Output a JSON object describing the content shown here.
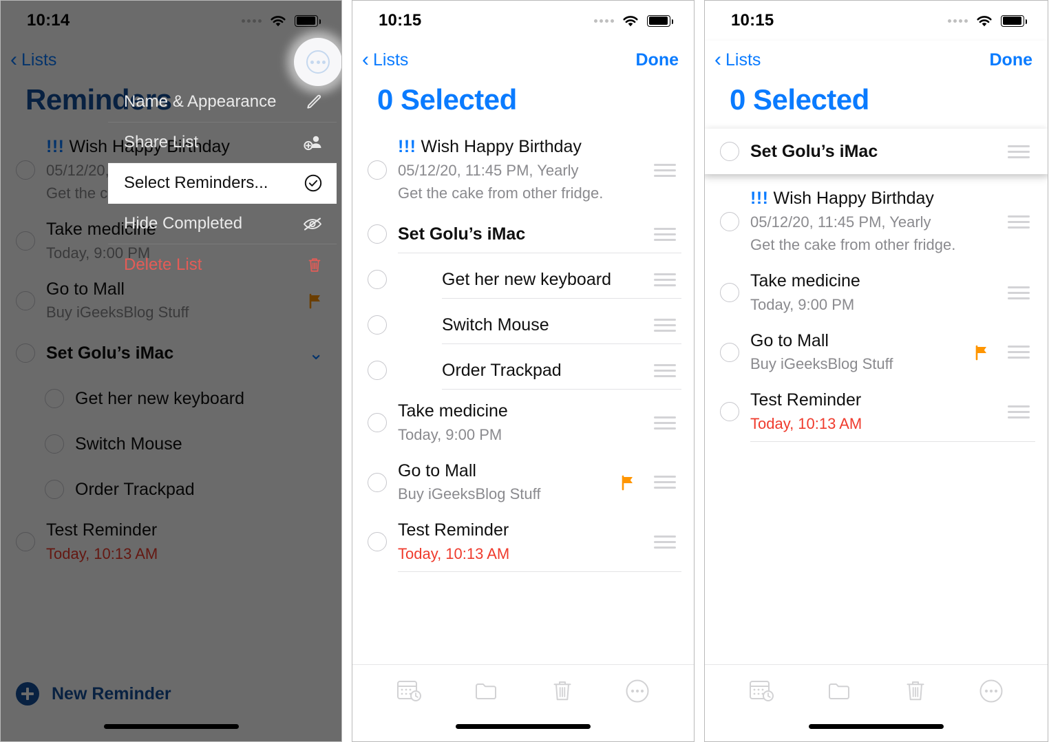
{
  "app": "Reminders",
  "panels": [
    {
      "id": "panel-context-menu",
      "status_bar": {
        "time": "10:14",
        "wifi_icon": "wifi-icon",
        "battery_icon": "battery-icon",
        "signal_icon": "signal-dots-icon"
      },
      "nav": {
        "back_label": "Lists",
        "back_icon": "chevron-left-icon",
        "more_icon": "ellipsis-circle-icon"
      },
      "title": "Reminders",
      "context_menu": [
        {
          "label": "Name & Appearance",
          "icon": "pencil-icon",
          "highlighted": false,
          "danger": false
        },
        {
          "label": "Share List",
          "icon": "person-add-icon",
          "highlighted": false,
          "danger": false
        },
        {
          "label": "Select Reminders...",
          "icon": "checkmark-circle-icon",
          "highlighted": true,
          "danger": false
        },
        {
          "label": "Hide Completed",
          "icon": "eye-slash-icon",
          "highlighted": false,
          "danger": false
        },
        {
          "label": "Delete List",
          "icon": "trash-icon",
          "highlighted": false,
          "danger": true
        }
      ],
      "reminders": [
        {
          "priority": "!!!",
          "title": "Wish Happy Birthday",
          "date": "05/12/20, 11:45 PM, Yearly",
          "note": "Get the cake from other fridge.",
          "bold": false,
          "indent": false,
          "flag": false,
          "chevron": false
        },
        {
          "priority": "",
          "title": "Take medicine",
          "date": "Today, 9:00 PM",
          "note": "",
          "bold": false,
          "indent": false,
          "flag": false,
          "chevron": false
        },
        {
          "priority": "",
          "title": "Go to Mall",
          "date": "Buy iGeeksBlog Stuff",
          "note": "",
          "bold": false,
          "indent": false,
          "flag": true,
          "chevron": false
        },
        {
          "priority": "",
          "title": "Set Golu’s iMac",
          "date": "",
          "note": "",
          "bold": true,
          "indent": false,
          "flag": false,
          "chevron": true
        },
        {
          "priority": "",
          "title": "Get her new keyboard",
          "date": "",
          "note": "",
          "bold": false,
          "indent": true,
          "flag": false,
          "chevron": false
        },
        {
          "priority": "",
          "title": "Switch Mouse",
          "date": "",
          "note": "",
          "bold": false,
          "indent": true,
          "flag": false,
          "chevron": false
        },
        {
          "priority": "",
          "title": "Order Trackpad",
          "date": "",
          "note": "",
          "bold": false,
          "indent": true,
          "flag": false,
          "chevron": false
        },
        {
          "priority": "",
          "title": "Test Reminder",
          "date": "Today, 10:13 AM",
          "note": "",
          "date_overdue": true,
          "bold": false,
          "indent": false,
          "flag": false,
          "chevron": false
        }
      ],
      "new_reminder": {
        "label": "New Reminder",
        "icon": "plus-circle-icon"
      }
    },
    {
      "id": "panel-select-mode",
      "status_bar": {
        "time": "10:15",
        "wifi_icon": "wifi-icon",
        "battery_icon": "battery-icon",
        "signal_icon": "signal-dots-icon"
      },
      "nav": {
        "back_label": "Lists",
        "back_icon": "chevron-left-icon",
        "done_label": "Done"
      },
      "title": "0 Selected",
      "reminders": [
        {
          "priority": "!!!",
          "title": "Wish Happy Birthday",
          "date": "05/12/20, 11:45 PM, Yearly",
          "note": "Get the cake from other fridge.",
          "bold": false,
          "indent": false,
          "flag": false,
          "grip": true
        },
        {
          "priority": "",
          "title": "Set Golu’s iMac",
          "date": "",
          "note": "",
          "bold": true,
          "indent": false,
          "flag": false,
          "grip": true
        },
        {
          "priority": "",
          "title": "Get her new keyboard",
          "date": "",
          "note": "",
          "bold": false,
          "indent": true,
          "flag": false,
          "grip": true
        },
        {
          "priority": "",
          "title": "Switch Mouse",
          "date": "",
          "note": "",
          "bold": false,
          "indent": true,
          "flag": false,
          "grip": true
        },
        {
          "priority": "",
          "title": "Order Trackpad",
          "date": "",
          "note": "",
          "bold": false,
          "indent": true,
          "flag": false,
          "grip": true
        },
        {
          "priority": "",
          "title": "Take medicine",
          "date": "Today, 9:00 PM",
          "note": "",
          "bold": false,
          "indent": false,
          "flag": false,
          "grip": true
        },
        {
          "priority": "",
          "title": "Go to Mall",
          "date": "Buy iGeeksBlog Stuff",
          "note": "",
          "bold": false,
          "indent": false,
          "flag": true,
          "grip": true
        },
        {
          "priority": "",
          "title": "Test Reminder",
          "date": "Today, 10:13 AM",
          "note": "",
          "date_overdue": true,
          "bold": false,
          "indent": false,
          "flag": false,
          "grip": true
        }
      ],
      "toolbar": [
        {
          "icon": "calendar-clock-icon",
          "name": "schedule-button"
        },
        {
          "icon": "folder-icon",
          "name": "move-to-list-button"
        },
        {
          "icon": "trash-icon",
          "name": "delete-button"
        },
        {
          "icon": "ellipsis-circle-icon",
          "name": "more-button"
        }
      ]
    },
    {
      "id": "panel-reorder",
      "status_bar": {
        "time": "10:15",
        "wifi_icon": "wifi-icon",
        "battery_icon": "battery-icon",
        "signal_icon": "signal-dots-icon"
      },
      "nav": {
        "back_label": "Lists",
        "back_icon": "chevron-left-icon",
        "done_label": "Done"
      },
      "title": "0 Selected",
      "dragged": {
        "priority": "",
        "title": "Set Golu’s iMac",
        "date": "",
        "note": "",
        "bold": true,
        "indent": false,
        "flag": false,
        "grip": true
      },
      "reminders": [
        {
          "priority": "!!!",
          "title": "Wish Happy Birthday",
          "date": "05/12/20, 11:45 PM, Yearly",
          "note": "Get the cake from other fridge.",
          "bold": false,
          "indent": false,
          "flag": false,
          "grip": true
        },
        {
          "priority": "",
          "title": "Take medicine",
          "date": "Today, 9:00 PM",
          "note": "",
          "bold": false,
          "indent": false,
          "flag": false,
          "grip": true
        },
        {
          "priority": "",
          "title": "Go to Mall",
          "date": "Buy iGeeksBlog Stuff",
          "note": "",
          "bold": false,
          "indent": false,
          "flag": true,
          "grip": true
        },
        {
          "priority": "",
          "title": "Test Reminder",
          "date": "Today, 10:13 AM",
          "note": "",
          "date_overdue": true,
          "bold": false,
          "indent": false,
          "flag": false,
          "grip": true
        }
      ],
      "toolbar": [
        {
          "icon": "calendar-clock-icon",
          "name": "schedule-button"
        },
        {
          "icon": "folder-icon",
          "name": "move-to-list-button"
        },
        {
          "icon": "trash-icon",
          "name": "delete-button"
        },
        {
          "icon": "ellipsis-circle-icon",
          "name": "more-button"
        }
      ]
    }
  ],
  "colors": {
    "accent_blue": "#0a7bff",
    "title_blue_dark": "#14509c",
    "overdue_red": "#ef3b2d",
    "flag_orange": "#ff9500",
    "delete_red": "#e45c57",
    "subtitle_gray": "#8a8a8e"
  }
}
